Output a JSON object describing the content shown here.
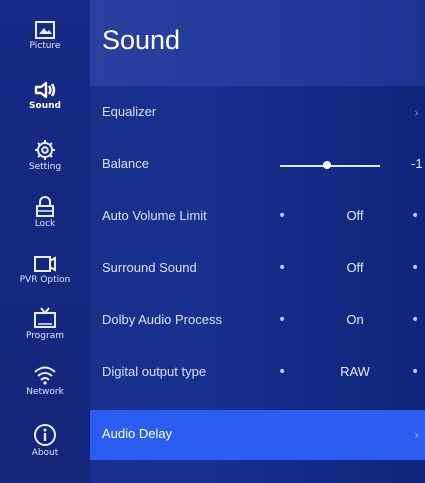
{
  "sidebar": {
    "items": [
      {
        "label": "Picture",
        "icon": "picture-icon"
      },
      {
        "label": "Sound",
        "icon": "speaker-icon"
      },
      {
        "label": "Setting",
        "icon": "gear-icon"
      },
      {
        "label": "Lock",
        "icon": "lock-icon"
      },
      {
        "label": "PVR Option",
        "icon": "record-icon"
      },
      {
        "label": "Program",
        "icon": "tv-icon"
      },
      {
        "label": "Network",
        "icon": "wifi-icon"
      },
      {
        "label": "About",
        "icon": "info-icon"
      }
    ],
    "active_index": 1
  },
  "page": {
    "title": "Sound"
  },
  "menu": {
    "items": [
      {
        "label": "Equalizer",
        "type": "submenu"
      },
      {
        "label": "Balance",
        "type": "slider",
        "value": "-1",
        "slider_fraction": 0.47
      },
      {
        "label": "Auto Volume Limit",
        "type": "option",
        "value": "Off"
      },
      {
        "label": "Surround Sound",
        "type": "option",
        "value": "Off"
      },
      {
        "label": "Dolby Audio Process",
        "type": "option",
        "value": "On"
      },
      {
        "label": "Digital output type",
        "type": "option",
        "value": "RAW"
      },
      {
        "label": "Audio Delay",
        "type": "submenu",
        "selected": true
      }
    ]
  },
  "colors": {
    "highlight": "#2c5df1",
    "background": "#18318f",
    "sidebar": "#162a86"
  }
}
